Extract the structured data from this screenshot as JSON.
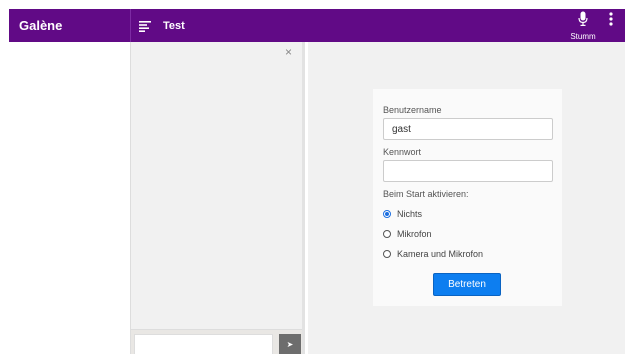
{
  "app": {
    "brand": "Galène"
  },
  "room": {
    "title": "Test"
  },
  "header": {
    "mute_label": "Stumm"
  },
  "chat": {
    "close_glyph": "×",
    "send_glyph": "➤"
  },
  "login": {
    "username_label": "Benutzername",
    "username_value": "gast",
    "password_label": "Kennwort",
    "password_value": "",
    "start_label": "Beim Start aktivieren:",
    "options": [
      {
        "label": "Nichts",
        "checked": true
      },
      {
        "label": "Mikrofon",
        "checked": false
      },
      {
        "label": "Kamera und Mikrofon",
        "checked": false
      }
    ],
    "join_label": "Betreten"
  },
  "colors": {
    "header_bg": "#610a86",
    "button": "#0d7ef0",
    "panel": "#f1f1f1"
  },
  "icons": [
    "menu-icon",
    "microphone-icon",
    "more-vertical-icon",
    "close-icon",
    "send-icon"
  ]
}
